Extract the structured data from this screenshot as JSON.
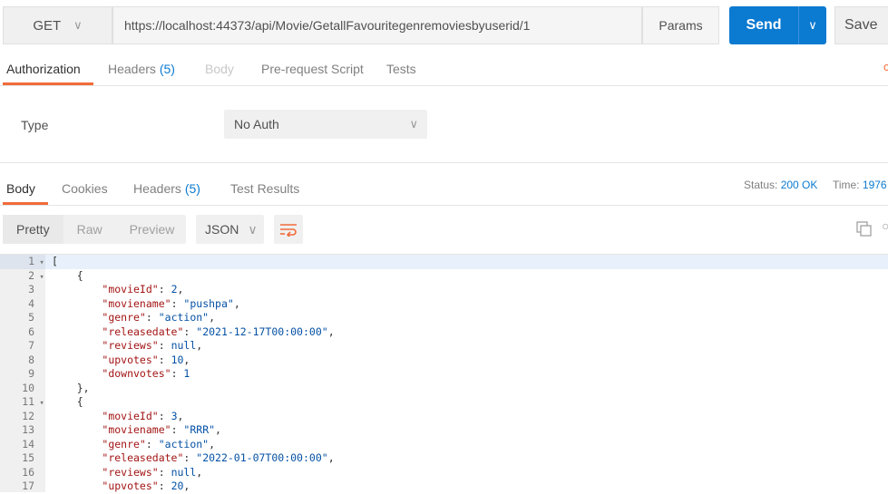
{
  "request": {
    "method": "GET",
    "url": "https://localhost:44373/api/Movie/GetallFavouritegenremoviesbyuserid/1",
    "params_label": "Params",
    "send_label": "Send",
    "save_label": "Save"
  },
  "request_tabs": [
    {
      "label": "Authorization",
      "count": ""
    },
    {
      "label": "Headers",
      "count": "(5)"
    },
    {
      "label": "Body",
      "count": ""
    },
    {
      "label": "Pre-request Script",
      "count": ""
    },
    {
      "label": "Tests",
      "count": ""
    }
  ],
  "auth": {
    "type_label": "Type",
    "type_value": "No Auth"
  },
  "response_tabs": [
    {
      "label": "Body",
      "count": ""
    },
    {
      "label": "Cookies",
      "count": ""
    },
    {
      "label": "Headers",
      "count": "(5)"
    },
    {
      "label": "Test Results",
      "count": ""
    }
  ],
  "status": {
    "status_label": "Status:",
    "status_value": "200 OK",
    "time_label": "Time:",
    "time_value": "1976"
  },
  "view_modes": [
    "Pretty",
    "Raw",
    "Preview"
  ],
  "format": "JSON",
  "code_lines": [
    "[",
    "    {",
    "        \"movieId\": 2,",
    "        \"moviename\": \"pushpa\",",
    "        \"genre\": \"action\",",
    "        \"releasedate\": \"2021-12-17T00:00:00\",",
    "        \"reviews\": null,",
    "        \"upvotes\": 10,",
    "        \"downvotes\": 1",
    "    },",
    "    {",
    "        \"movieId\": 3,",
    "        \"moviename\": \"RRR\",",
    "        \"genre\": \"action\",",
    "        \"releasedate\": \"2022-01-07T00:00:00\",",
    "        \"reviews\": null,",
    "        \"upvotes\": 20,"
  ],
  "folded_lines": [
    1,
    2,
    11
  ],
  "colors": {
    "accent": "#f26b3a",
    "primary": "#0b7ad1"
  }
}
